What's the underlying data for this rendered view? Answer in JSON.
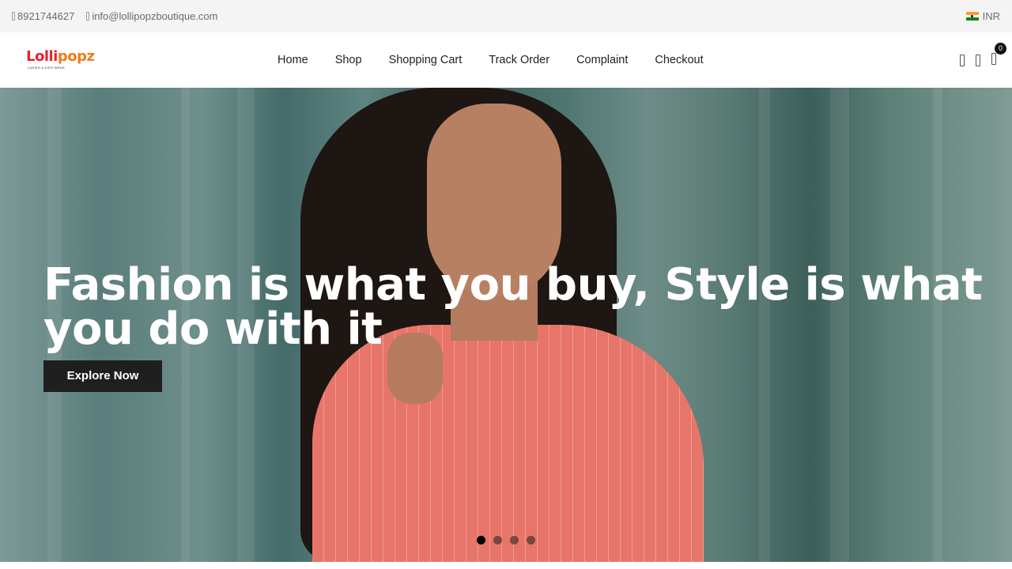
{
  "topbar": {
    "phone": "8921744627",
    "email": "info@lollipopzboutique.com",
    "currency": "INR",
    "currency_flag": "india-flag-icon"
  },
  "header": {
    "logo_text_part1": "Lolli",
    "logo_text_part2": "popz",
    "logo_tagline": "LADIES & KIDS WEAR",
    "nav": [
      {
        "label": "Home"
      },
      {
        "label": "Shop"
      },
      {
        "label": "Shopping Cart"
      },
      {
        "label": "Track Order"
      },
      {
        "label": "Complaint"
      },
      {
        "label": "Checkout"
      }
    ],
    "icons": [
      "search-icon",
      "user-icon",
      "cart-icon"
    ],
    "cart_count": "0"
  },
  "hero": {
    "title": "Fashion is what you buy, Style is what you do with it",
    "cta_label": "Explore Now",
    "slides_total": 4,
    "active_slide": 1
  },
  "colors": {
    "button_bg": "#1f1f1f",
    "topbar_bg": "#f4f4f5",
    "logo_red": "#e8222d",
    "logo_orange": "#f07a1a"
  }
}
